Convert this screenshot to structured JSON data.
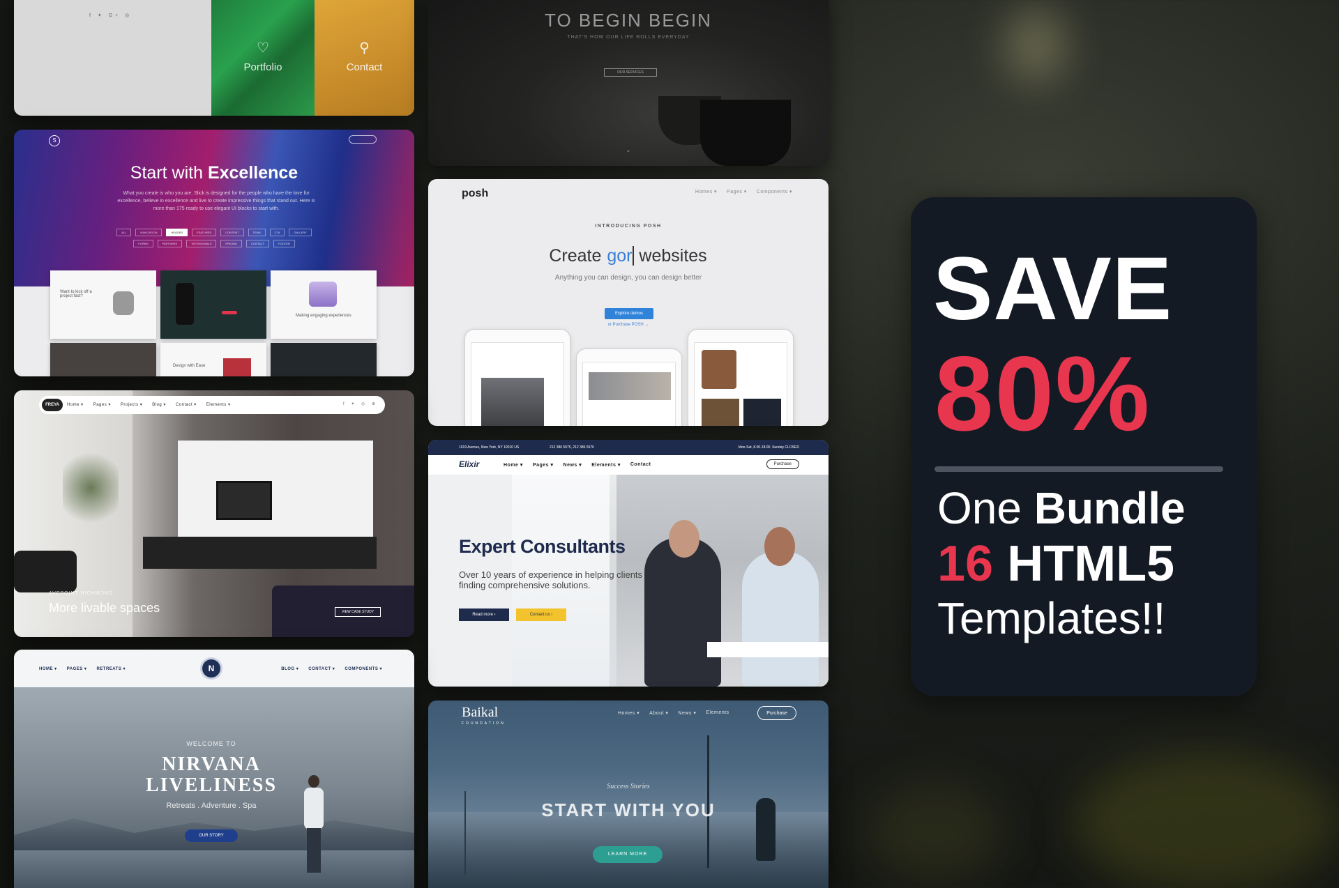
{
  "promo": {
    "save": "SAVE",
    "percent": "80%",
    "line1_light": "One",
    "line1_bold": "Bundle",
    "line2_accent": "16",
    "line2_bold": "HTML5",
    "line3": "Templates!!",
    "accent_color": "#e8364f",
    "panel_color": "#141a24"
  },
  "templates": {
    "card1": {
      "portfolio": "Portfolio",
      "contact": "Contact",
      "portfolio_icon": "heart-icon",
      "contact_icon": "pin-icon"
    },
    "card2": {
      "title": "TO BEGIN BEGIN",
      "subtitle": "THAT'S HOW OUR LIFE ROLLS EVERYDAY",
      "button": "OUR SERVICES"
    },
    "card3": {
      "title_light": "Start with",
      "title_bold": "Excellence",
      "description": "What you create is who you are. Slick is designed for the people who have the love for excellence, believe in excellence and live to create impressive things that stand out. Here is more than 175 ready to use elegant UI blocks to start with.",
      "chips_row1": [
        "ALL",
        "NAVIGATION",
        "HEADER",
        "FEATURES",
        "CONTENT",
        "TEAM",
        "CTA",
        "GALLERY"
      ],
      "chips_row2": [
        "FORMS",
        "PARTNERS",
        "TESTIMONIALS",
        "PRICING",
        "CONTACT",
        "FOOTER"
      ],
      "mini1": "Want to kick off a project fast?",
      "mini2": "Making engaging experiences",
      "mini3": "Design with Ease"
    },
    "card4": {
      "logo": "posh",
      "nav": [
        "Homes ▾",
        "Pages ▾",
        "Components ▾"
      ],
      "intro": "INTRODUCING POSH",
      "title_pre": "Create",
      "title_typed": "gor",
      "title_post": "websites",
      "subtitle": "Anything you can design, you can design better",
      "cta": "Explore demos",
      "purchase": "or Purchase POSH →"
    },
    "card5": {
      "brand": "FREYA",
      "nav": [
        "Home ▾",
        "Pages ▾",
        "Projects ▾",
        "Blog ▾",
        "Contact ▾",
        "Elements ▾"
      ],
      "kicker": "AVEPOINT RICHMOND",
      "title": "More livable spaces",
      "case": "VIEW CASE STUDY"
    },
    "card6": {
      "address": "1919 Avenue, New York, NY 10010 US",
      "phone": "212 386 5575, 212 386 5576",
      "hours": "Mon-Sat, 8.00-18.00. Sunday CLOSED",
      "logo": "Elixir",
      "nav": [
        "Home ▾",
        "Pages ▾",
        "News ▾",
        "Elements ▾",
        "Contact"
      ],
      "purchase": "Purchase",
      "title": "Expert Consultants",
      "description": "Over 10 years of experience in helping clients finding comprehensive solutions.",
      "read_more": "Read more ›",
      "contact_us": "Contact us ›"
    },
    "card7": {
      "nav_left": [
        "HOME ▾",
        "PAGES ▾",
        "RETREATS ▾"
      ],
      "nav_right": [
        "BLOG ▾",
        "CONTACT ▾",
        "COMPONENTS ▾"
      ],
      "badge": "N",
      "welcome": "WELCOME TO",
      "title1": "NIRVANA",
      "title2": "LIVELINESS",
      "tagline": "Retreats . Adventure . Spa",
      "button": "OUR STORY"
    },
    "card8": {
      "logo": "Baikal",
      "logo_sub": "FOUNDATION",
      "nav": [
        "Homes ▾",
        "About ▾",
        "News ▾",
        "Elements"
      ],
      "purchase": "Purchase",
      "kicker": "Success Stories",
      "title": "START WITH YOU",
      "button": "LEARN MORE"
    }
  }
}
